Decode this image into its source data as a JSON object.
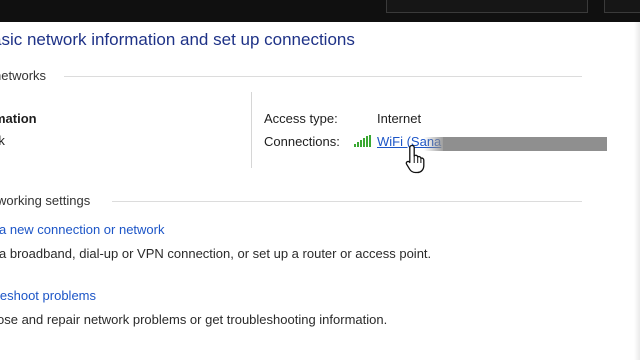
{
  "header": {
    "title": "asic network information and set up connections"
  },
  "active_networks": {
    "section_label": "networks",
    "network_name": "mation",
    "network_type": "rk",
    "access_type_label": "Access type:",
    "access_type_value": "Internet",
    "connections_label": "Connections:",
    "connection_icon": "wifi-signal-icon",
    "connection_link": "WiFi (Sana"
  },
  "change_settings": {
    "section_label": "working settings",
    "tasks": [
      {
        "link": "a new connection or network",
        "description": "a broadband, dial-up or VPN connection, or set up a router or access point."
      },
      {
        "link": "leshoot problems",
        "description": "ose and repair network problems or get troubleshooting information."
      }
    ]
  },
  "colors": {
    "title": "#1e3287",
    "link": "#1c55c7",
    "signal": "#3aa832",
    "redaction": "#8f8f8f"
  }
}
